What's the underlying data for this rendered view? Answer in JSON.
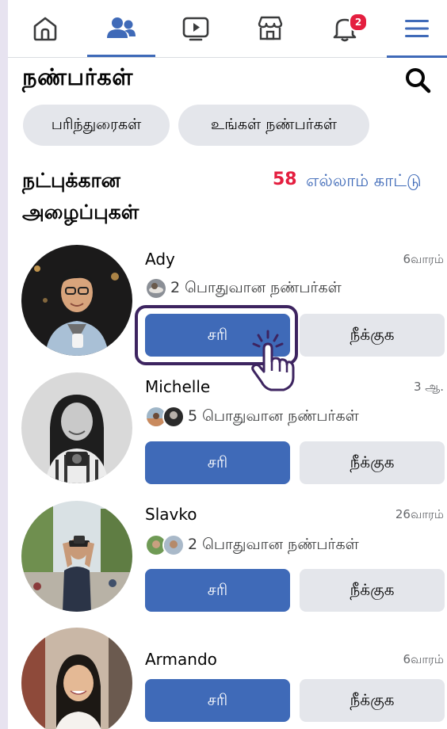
{
  "nav": {
    "tabs": [
      {
        "name": "home",
        "icon": "home-icon"
      },
      {
        "name": "friends",
        "icon": "friends-icon",
        "active": true
      },
      {
        "name": "watch",
        "icon": "video-icon"
      },
      {
        "name": "marketplace",
        "icon": "marketplace-icon"
      },
      {
        "name": "notifications",
        "icon": "bell-icon",
        "badge": "2"
      },
      {
        "name": "menu",
        "icon": "hamburger-icon"
      }
    ],
    "notifications_badge": "2"
  },
  "header": {
    "title": "நண்பர்கள்"
  },
  "chips": {
    "suggestions": "பரிந்துரைகள்",
    "your_friends": "உங்கள் நண்பர்கள்"
  },
  "requests_section": {
    "title": "நட்புக்கான அழைப்புகள்",
    "count": "58",
    "see_all": "எல்லாம் காட்டு"
  },
  "requests": [
    {
      "name": "Ady",
      "time": "6வாரம்",
      "mutual": "2 பொதுவான நண்பர்கள்",
      "accept": "சரி",
      "remove": "நீக்குக"
    },
    {
      "name": "Michelle",
      "time": "3 ஆ.",
      "mutual": "5 பொதுவான நண்பர்கள்",
      "accept": "சரி",
      "remove": "நீக்குக"
    },
    {
      "name": "Slavko",
      "time": "26வாரம்",
      "mutual": "2 பொதுவான நண்பர்கள்",
      "accept": "சரி",
      "remove": "நீக்குக"
    },
    {
      "name": "Armando",
      "time": "6வாரம்",
      "mutual": "",
      "accept": "சரி",
      "remove": "நீக்குக"
    }
  ],
  "colors": {
    "accent": "#3f6ab8",
    "badge": "#e41e3f",
    "chip_bg": "#e4e6eb",
    "highlight": "#3d2460"
  }
}
